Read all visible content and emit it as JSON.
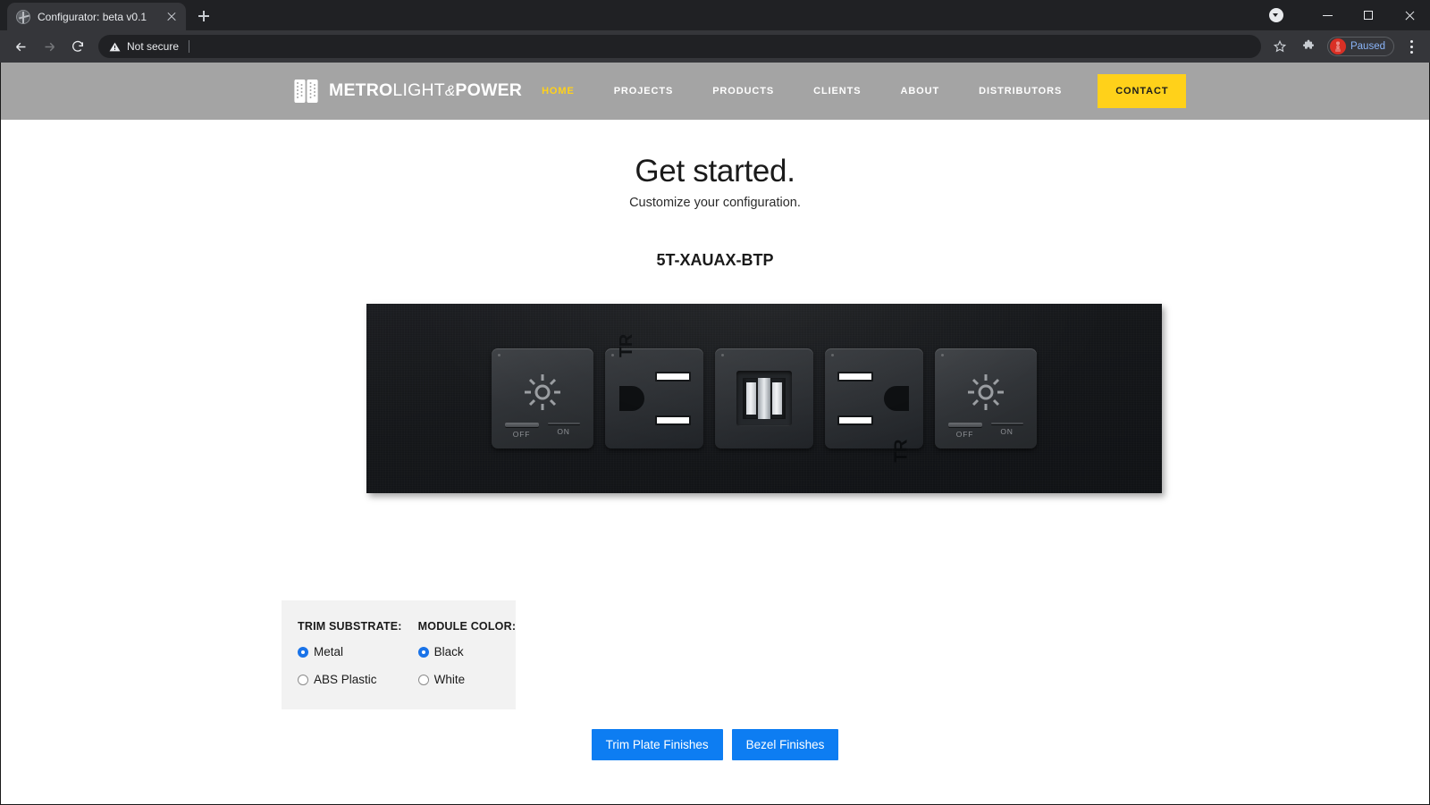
{
  "browser": {
    "tab": {
      "title": "Configurator: beta v0.1",
      "favicon": "globe-icon",
      "close": "close-icon"
    },
    "new_tab_label": "+",
    "window_controls": {
      "minimize": "minimize-icon",
      "maximize": "maximize-icon",
      "close": "close-icon"
    },
    "toolbar": {
      "back": "back-arrow-icon",
      "forward": "forward-arrow-icon",
      "reload": "reload-icon",
      "security_label": "Not secure",
      "url_value": "",
      "url_placeholder": "",
      "bookmark": "star-icon",
      "extensions": "puzzle-icon",
      "profile_label": "Paused",
      "menu": "kebab-menu-icon"
    }
  },
  "site": {
    "brand": {
      "mark": "shield-plates-icon",
      "part1": "METRO",
      "part2": "LIGHT",
      "part3": "&",
      "part4": "POWER"
    },
    "nav": [
      {
        "label": "HOME",
        "active": true
      },
      {
        "label": "PROJECTS",
        "active": false
      },
      {
        "label": "PRODUCTS",
        "active": false
      },
      {
        "label": "CLIENTS",
        "active": false
      },
      {
        "label": "ABOUT",
        "active": false
      },
      {
        "label": "DISTRIBUTORS",
        "active": false
      }
    ],
    "cta_label": "CONTACT",
    "colors": {
      "header_bg": "#a4a4a4",
      "accent_yellow": "#ffd11a",
      "button_blue": "#0d7df2"
    }
  },
  "hero": {
    "title": "Get started.",
    "subtitle": "Customize your configuration.",
    "part_number": "5T-XAUAX-BTP"
  },
  "product": {
    "trim_plate_finish": "Black textured metal",
    "modules": [
      {
        "type": "dimmer-switch",
        "icon": "sun-icon",
        "off_label": "OFF",
        "on_label": "ON",
        "state": "off"
      },
      {
        "type": "outlet",
        "marking": "TR",
        "orientation": "ground-left"
      },
      {
        "type": "usb-charger",
        "ports": 2
      },
      {
        "type": "outlet",
        "marking": "TR",
        "orientation": "ground-right"
      },
      {
        "type": "dimmer-switch",
        "icon": "sun-icon",
        "off_label": "OFF",
        "on_label": "ON",
        "state": "off"
      }
    ]
  },
  "options": {
    "groups": [
      {
        "title": "TRIM SUBSTRATE:",
        "items": [
          {
            "label": "Metal",
            "checked": true
          },
          {
            "label": "ABS Plastic",
            "checked": false
          }
        ]
      },
      {
        "title": "MODULE COLOR:",
        "items": [
          {
            "label": "Black",
            "checked": true
          },
          {
            "label": "White",
            "checked": false
          }
        ]
      }
    ]
  },
  "actions": {
    "trim_plate_finishes": "Trim Plate Finishes",
    "bezel_finishes": "Bezel Finishes"
  }
}
